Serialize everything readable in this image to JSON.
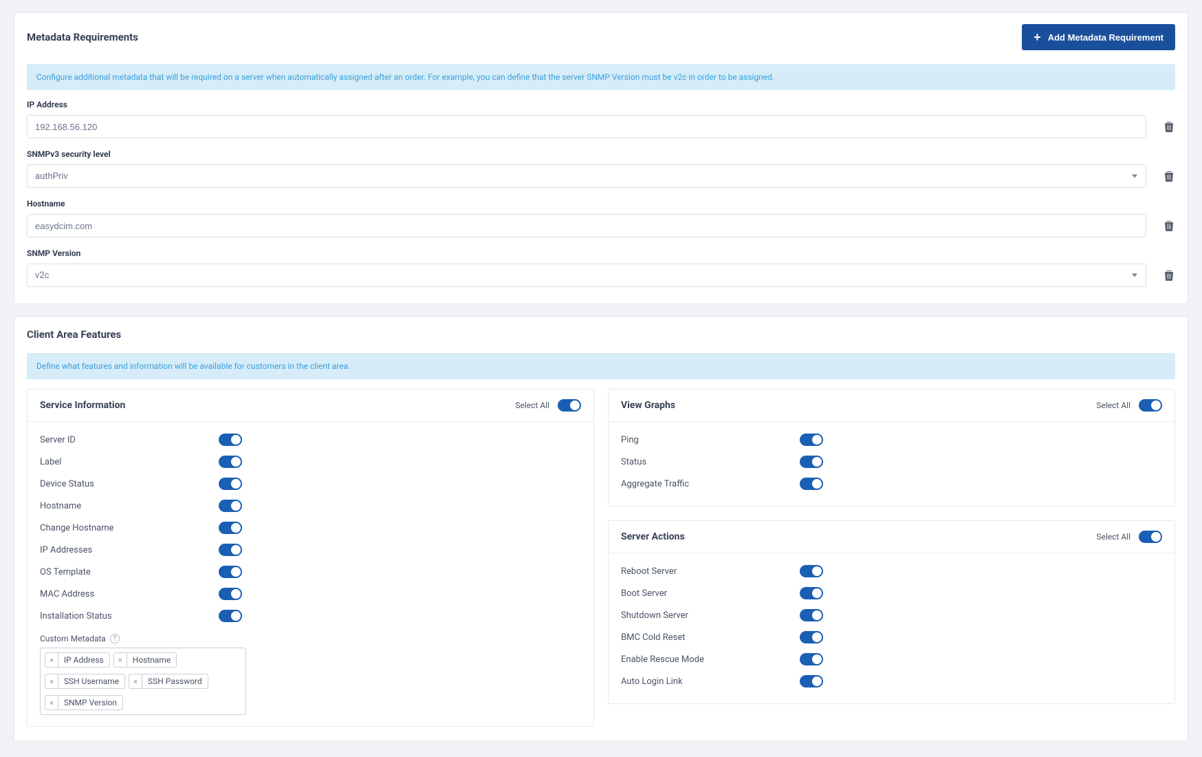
{
  "metadata": {
    "title": "Metadata Requirements",
    "add_btn": "Add Metadata Requirement",
    "info": "Configure additional metadata that will be required on a server when automatically assigned after an order. For example, you can define that the server SNMP Version must be v2c in order to be assigned.",
    "fields": {
      "ip_label": "IP Address",
      "ip_value": "192.168.56.120",
      "sec_label": "SNMPv3 security level",
      "sec_value": "authPriv",
      "host_label": "Hostname",
      "host_value": "easydcim.com",
      "snmp_label": "SNMP Version",
      "snmp_value": "v2c"
    }
  },
  "client": {
    "title": "Client Area Features",
    "info": "Define what features and information will be available for customers in the client area.",
    "select_all": "Select All",
    "service_info": {
      "title": "Service Information",
      "rows": {
        "server_id": "Server ID",
        "label": "Label",
        "device_status": "Device Status",
        "hostname": "Hostname",
        "change_hostname": "Change Hostname",
        "ip_addresses": "IP Addresses",
        "os_template": "OS Template",
        "mac_address": "MAC Address",
        "install_status": "Installation Status"
      },
      "custom_meta_label": "Custom Metadata",
      "tags": {
        "t0": "IP Address",
        "t1": "Hostname",
        "t2": "SSH Username",
        "t3": "SSH Password",
        "t4": "SNMP Version"
      }
    },
    "view_graphs": {
      "title": "View Graphs",
      "rows": {
        "ping": "Ping",
        "status": "Status",
        "agg": "Aggregate Traffic"
      }
    },
    "server_actions": {
      "title": "Server Actions",
      "rows": {
        "reboot": "Reboot Server",
        "boot": "Boot Server",
        "shutdown": "Shutdown Server",
        "bmc": "BMC Cold Reset",
        "rescue": "Enable Rescue Mode",
        "auto_login": "Auto Login Link"
      }
    }
  }
}
